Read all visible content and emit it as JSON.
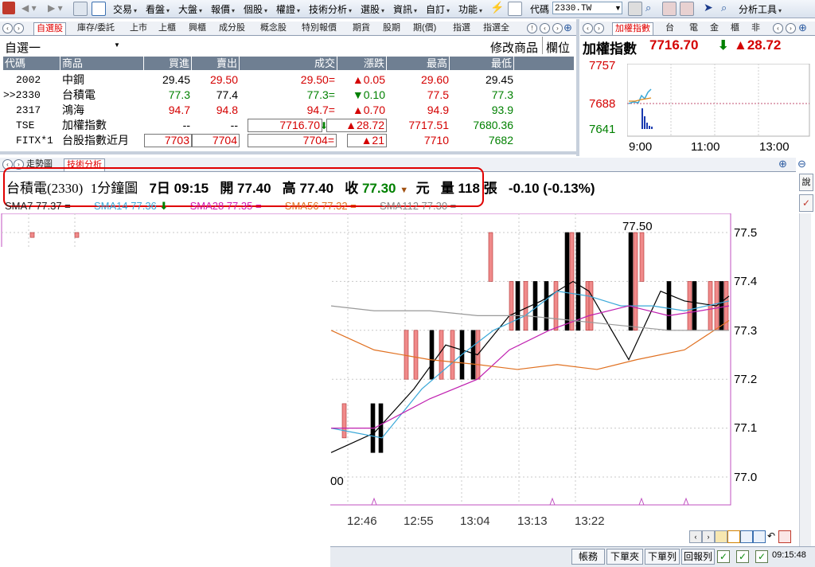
{
  "toolbar": {
    "menus": [
      "交易",
      "看盤",
      "大盤",
      "報價",
      "個股",
      "權證",
      "技術分析",
      "選股",
      "資訊",
      "自訂",
      "功能"
    ],
    "code_label": "代碼",
    "code_value": "2330.TW",
    "analysis_tools": "分析工具"
  },
  "watch_tabs": [
    "自選股",
    "庫存/委託",
    "上市",
    "上櫃",
    "興櫃",
    "成分股",
    "概念股",
    "特別報價",
    "期貨",
    "股期",
    "期(價)",
    "指選",
    "指選全"
  ],
  "watchlist": {
    "name": "自選一",
    "edit_label": "修改商品",
    "field_label": "欄位",
    "columns": [
      "代碼",
      "商品",
      "買進",
      "賣出",
      "成交",
      "漲跌",
      "最高",
      "最低"
    ],
    "rows": [
      {
        "code": "2002",
        "name": "中鋼",
        "bid": "29.45",
        "ask": "29.50",
        "last": "29.50=",
        "change": "▲0.05",
        "high": "29.60",
        "low": "29.45"
      },
      {
        "code": ">>2330",
        "name": "台積電",
        "bid": "77.3",
        "ask": "77.4",
        "last": "77.3=",
        "change": "▼0.10",
        "high": "77.5",
        "low": "77.3"
      },
      {
        "code": "2317",
        "name": "鴻海",
        "bid": "94.7",
        "ask": "94.8",
        "last": "94.7=",
        "change": "▲0.70",
        "high": "94.9",
        "low": "93.9"
      },
      {
        "code": "TSE",
        "name": "加權指數",
        "bid": "--",
        "ask": "--",
        "last": "7716.70",
        "change": "▲28.72",
        "high": "7717.51",
        "low": "7680.36"
      },
      {
        "code": "FITX*1",
        "name": "台股指數近月",
        "bid": "7703",
        "ask": "7704",
        "last": "7704=",
        "change": "▲21",
        "high": "7710",
        "low": "7682"
      }
    ]
  },
  "index_tabs": [
    "加權指數",
    "台",
    "電",
    "金",
    "櫃",
    "非"
  ],
  "index": {
    "title": "加權指數",
    "value": "7716.70",
    "change": "▲28.72",
    "y_labels": [
      "7757",
      "7688",
      "7641"
    ],
    "x_labels": [
      "9:00",
      "11:00",
      "13:00"
    ]
  },
  "chart_tabs": [
    "走勢圖",
    "技術分析"
  ],
  "chart_header": {
    "stock": "台積電(2330)",
    "period": "1分鐘圖",
    "date": "7日",
    "time": "09:15",
    "open_label": "開",
    "open": "77.40",
    "high_label": "高",
    "high": "77.40",
    "close_label": "收",
    "close": "77.30",
    "currency": "元",
    "volume_label": "量",
    "volume": "118",
    "volume_unit": "張",
    "change": "-0.10 (-0.13%)"
  },
  "ma_legend": [
    "SMA7 77.37 =",
    "SMA14 77.36",
    "SMA28 77.35 =",
    "SMA56 77.32 =",
    "SMA112 77.30 ="
  ],
  "chart_data": {
    "type": "candlestick",
    "y_ticks": [
      "77.5",
      "77.4",
      "77.3",
      "77.2",
      "77.1",
      "77.0"
    ],
    "x_ticks": [
      "12:46",
      "12:55",
      "13:04",
      "13:13",
      "13:22"
    ],
    "annotations": [
      "77.50",
      "00"
    ]
  },
  "status_bar": {
    "buttons": [
      "帳務",
      "下單夾",
      "下單列",
      "回報列"
    ],
    "clock": "09:15:48"
  },
  "colors": {
    "accent_red": "#d40000",
    "up_red": "#e23b3b",
    "down_green": "#008000",
    "highlight_box": "#e00000",
    "header_bg": "#6f7f92"
  }
}
